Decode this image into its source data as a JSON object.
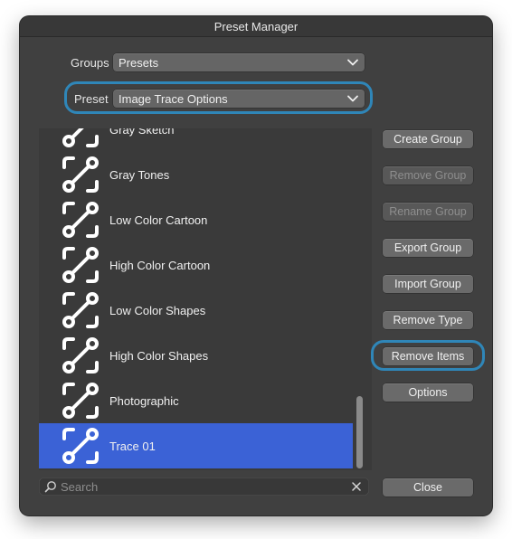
{
  "window": {
    "title": "Preset Manager"
  },
  "groups": {
    "label": "Groups",
    "value": "Presets"
  },
  "preset": {
    "label": "Preset",
    "value": "Image Trace Options"
  },
  "list": {
    "items": [
      {
        "label": "Gray Sketch"
      },
      {
        "label": "Gray Tones"
      },
      {
        "label": "Low Color Cartoon"
      },
      {
        "label": "High Color Cartoon"
      },
      {
        "label": "Low Color Shapes"
      },
      {
        "label": "High Color Shapes"
      },
      {
        "label": "Photographic"
      },
      {
        "label": "Trace 01",
        "selected": true
      }
    ],
    "item_icon": "trace-preset-icon"
  },
  "buttons": {
    "create_group": "Create Group",
    "remove_group": "Remove Group",
    "rename_group": "Rename Group",
    "export_group": "Export Group",
    "import_group": "Import Group",
    "remove_type": "Remove Type",
    "remove_items": "Remove Items",
    "options": "Options",
    "close": "Close"
  },
  "search": {
    "placeholder": "Search"
  },
  "colors": {
    "dialog_bg": "#404040",
    "selection": "#3b62d6",
    "focus_ring": "#2f86b8",
    "button_bg": "#6a6a6a"
  }
}
